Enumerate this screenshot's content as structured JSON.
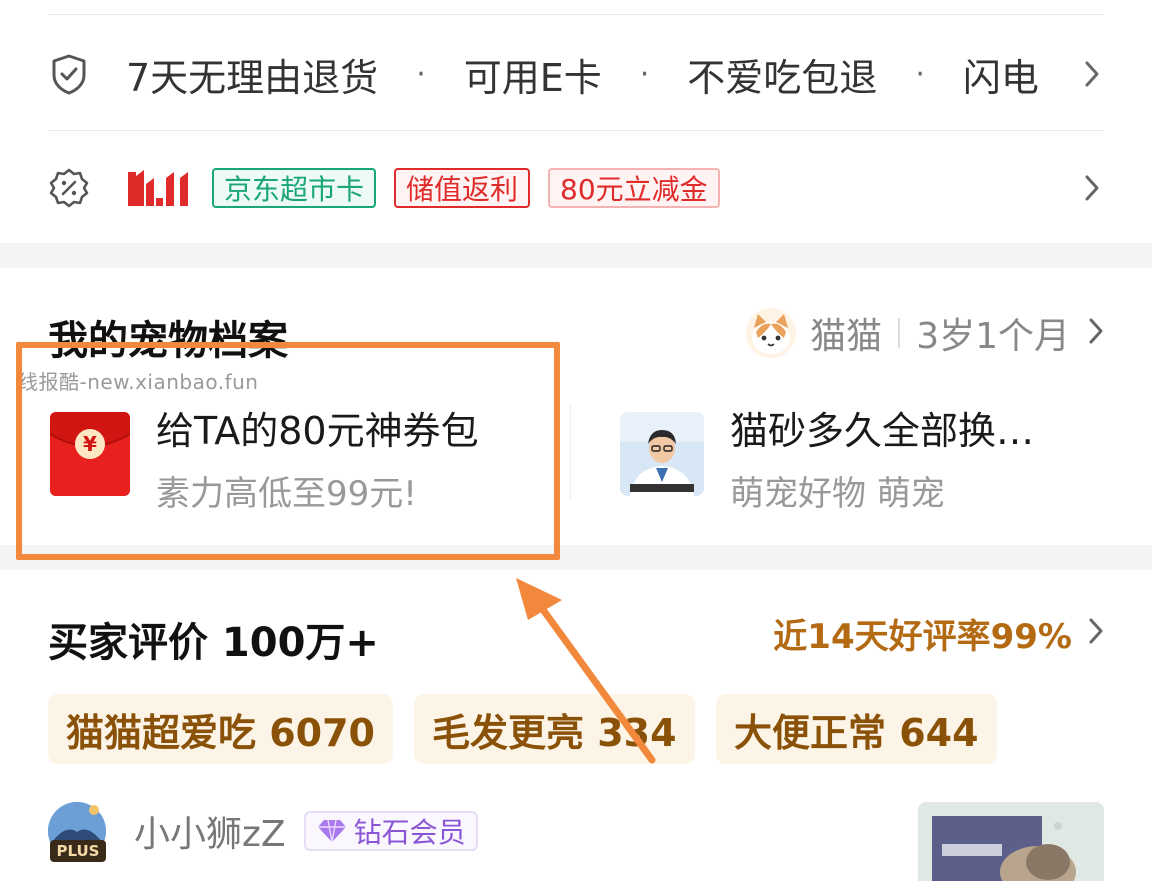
{
  "services": {
    "items": [
      "7天无理由退货",
      "可用E卡",
      "不爱吃包退",
      "闪电"
    ],
    "separator": "·"
  },
  "promo": {
    "logo_text": "11.11",
    "tags": [
      "京东超市卡",
      "储值返利",
      "80元立减金"
    ],
    "brand_red": "#e02b2b",
    "brand_green": "#1aa57a"
  },
  "pet_profile": {
    "title": "我的宠物档案",
    "pet_name": "猫猫",
    "pet_age": "3岁1个月",
    "watermark": "线报酷-new.xianbao.fun",
    "coupon_pack": {
      "title": "给TA的80元神券包",
      "subtitle": "素力高低至99元!",
      "icon_glyph": "¥"
    },
    "video": {
      "title": "猫砂多久全部换…",
      "subtitle": "萌宠好物  萌宠"
    }
  },
  "reviews": {
    "title": "买家评价 100万+",
    "rate_text": "近14天好评率99%",
    "chips": [
      "猫猫超爱吃 6070",
      "毛发更亮 334",
      "大便正常 644"
    ],
    "user": {
      "name": "小小狮zZ",
      "plus_label": "PLUS",
      "member_badge": "钻石会员"
    }
  },
  "colors": {
    "highlight": "#f2883c",
    "rate_color": "#b36a12",
    "chip_bg": "#fdf4e8"
  }
}
